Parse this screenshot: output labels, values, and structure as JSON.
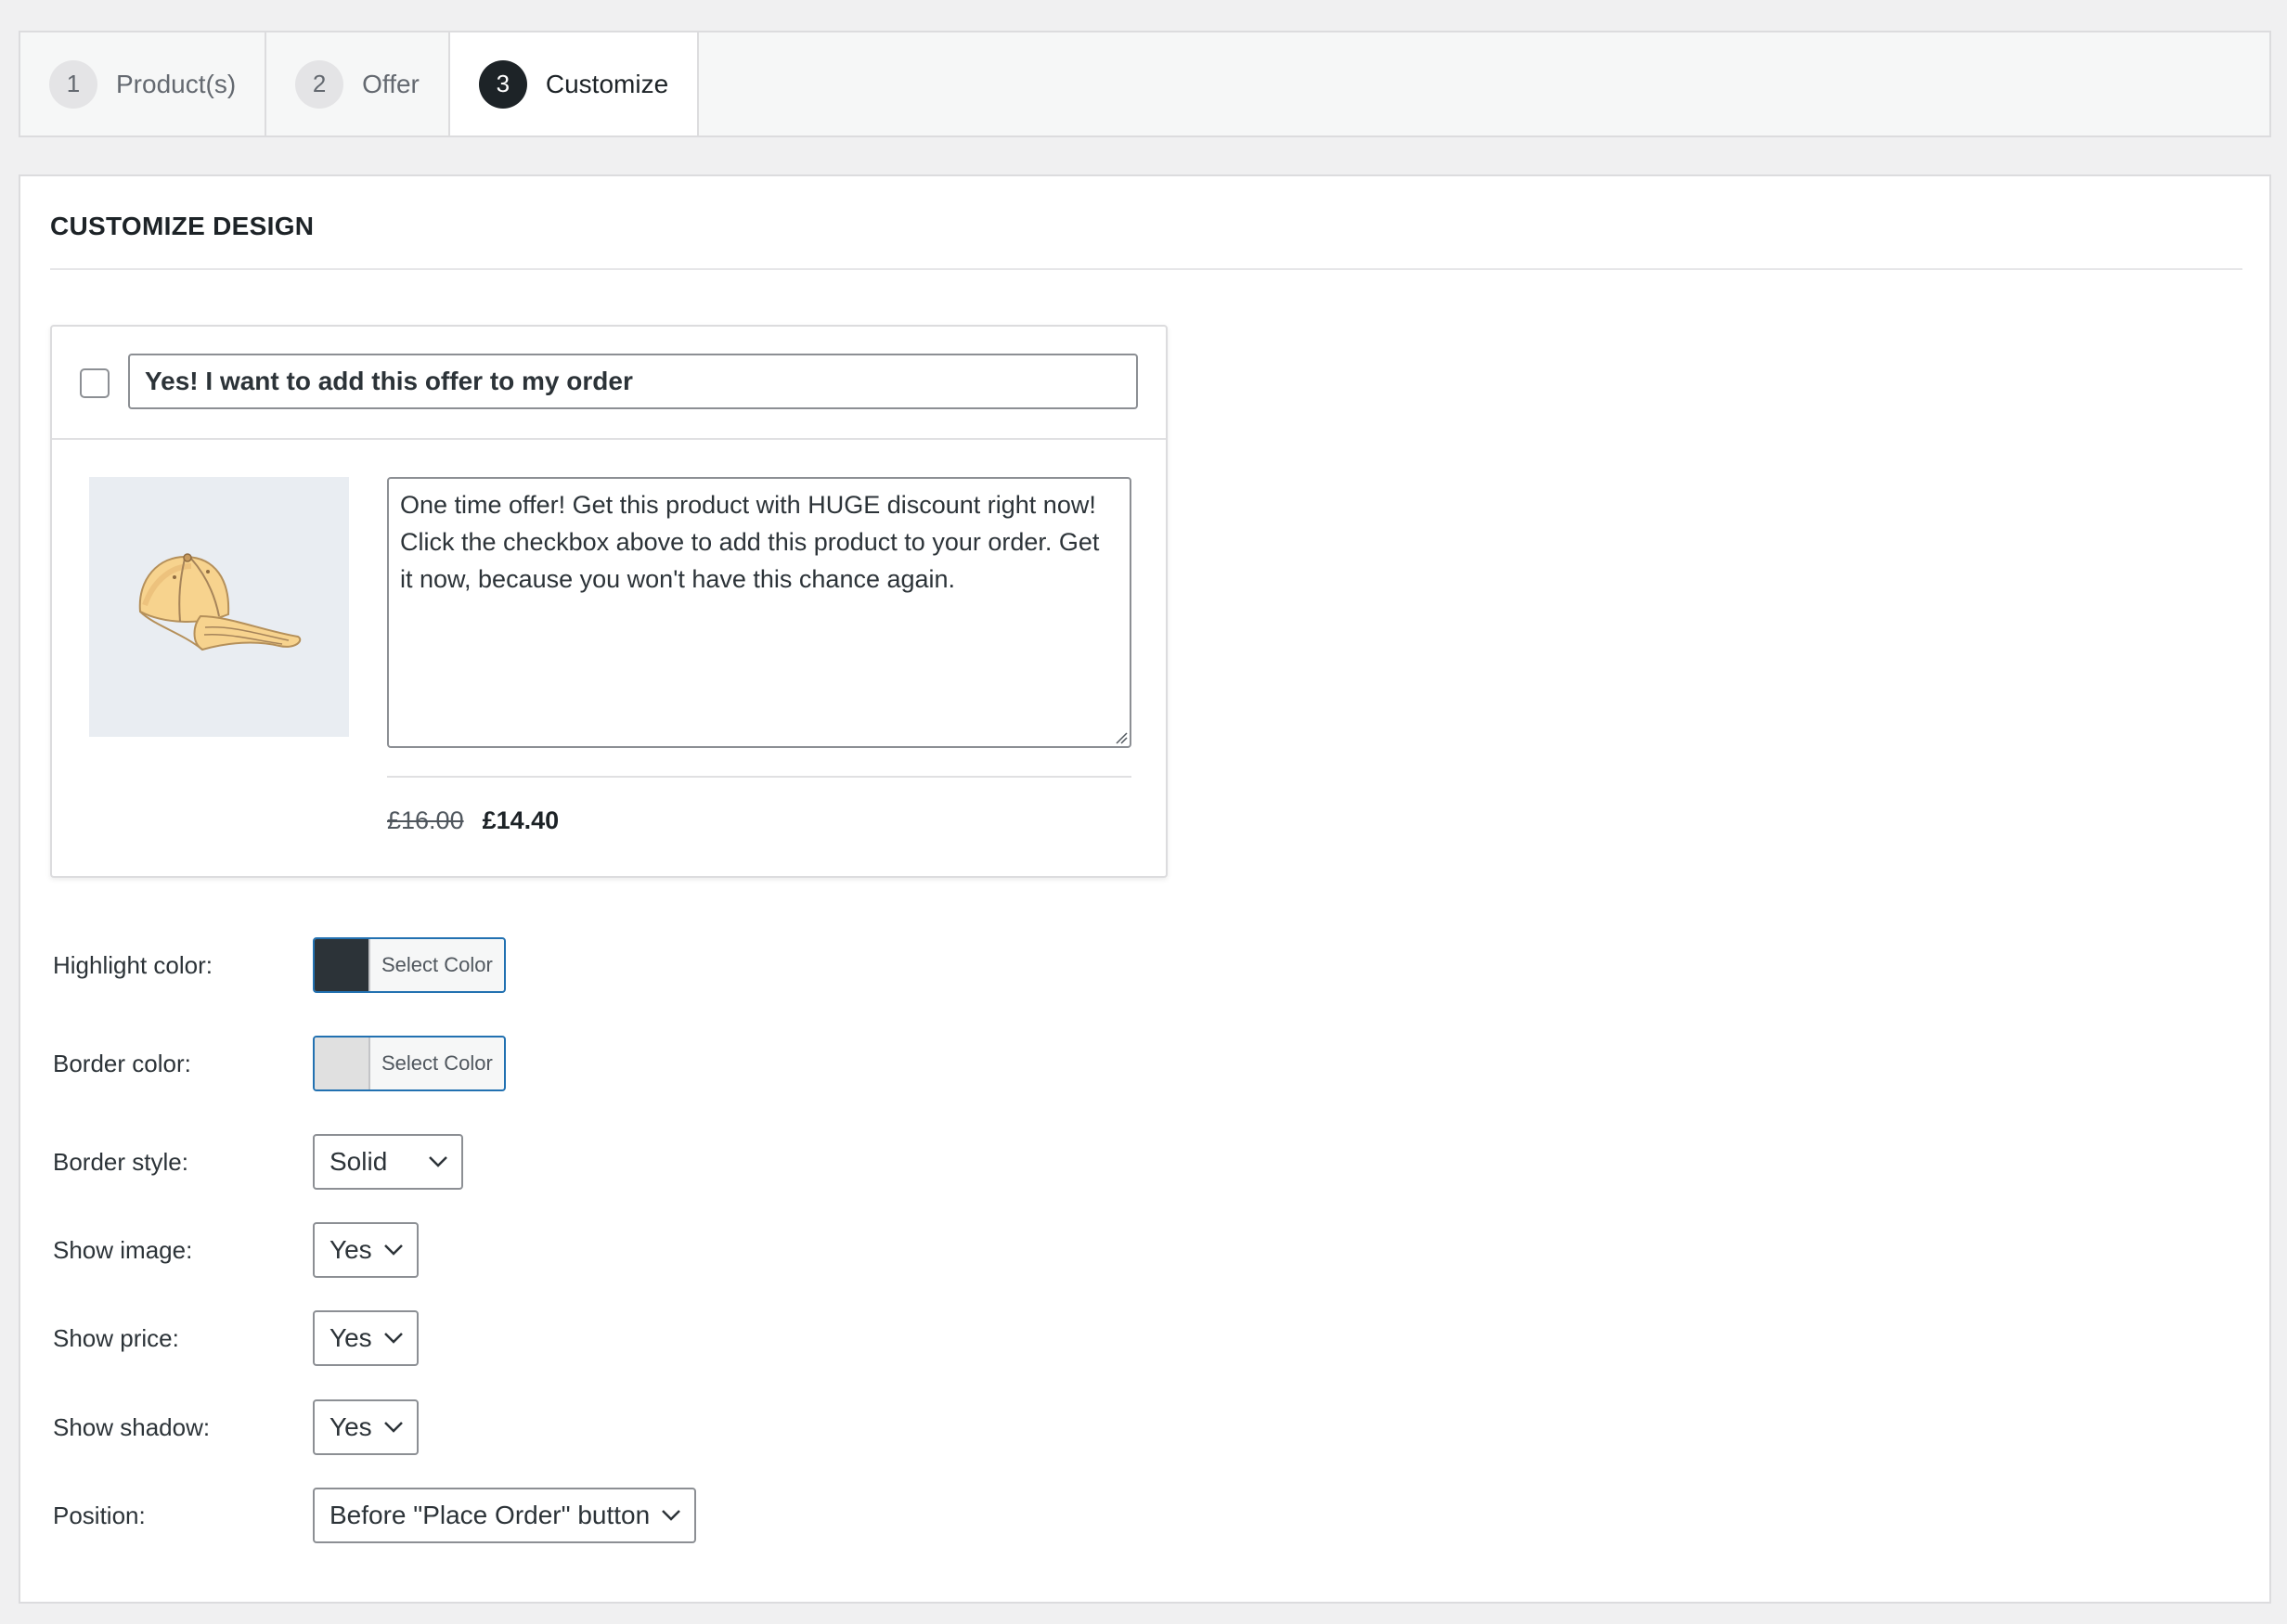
{
  "steps": [
    {
      "num": "1",
      "label": "Product(s)"
    },
    {
      "num": "2",
      "label": "Offer"
    },
    {
      "num": "3",
      "label": "Customize"
    }
  ],
  "active_step": 3,
  "panel": {
    "title": "CUSTOMIZE DESIGN"
  },
  "preview": {
    "checkbox_checked": false,
    "title_value": "Yes! I want to add this offer to my order",
    "description_value": "One time offer! Get this product with HUGE discount right now! Click the checkbox above to add this product to your order. Get it now, because you won't have this chance again.",
    "image_icon": "baseball-cap-image",
    "price_old": "£16.00",
    "price_new": "£14.40"
  },
  "settings": {
    "highlight_color": {
      "label": "Highlight color:",
      "button": "Select Color",
      "value": "#2c3338"
    },
    "border_color": {
      "label": "Border color:",
      "button": "Select Color",
      "value": "#e0e0e0"
    },
    "border_style": {
      "label": "Border style:",
      "value": "Solid"
    },
    "show_image": {
      "label": "Show image:",
      "value": "Yes"
    },
    "show_price": {
      "label": "Show price:",
      "value": "Yes"
    },
    "show_shadow": {
      "label": "Show shadow:",
      "value": "Yes"
    },
    "position": {
      "label": "Position:",
      "value": "Before \"Place Order\" button"
    }
  },
  "colors": {
    "accent": "#2271b1",
    "active_step": "#1d2327"
  }
}
